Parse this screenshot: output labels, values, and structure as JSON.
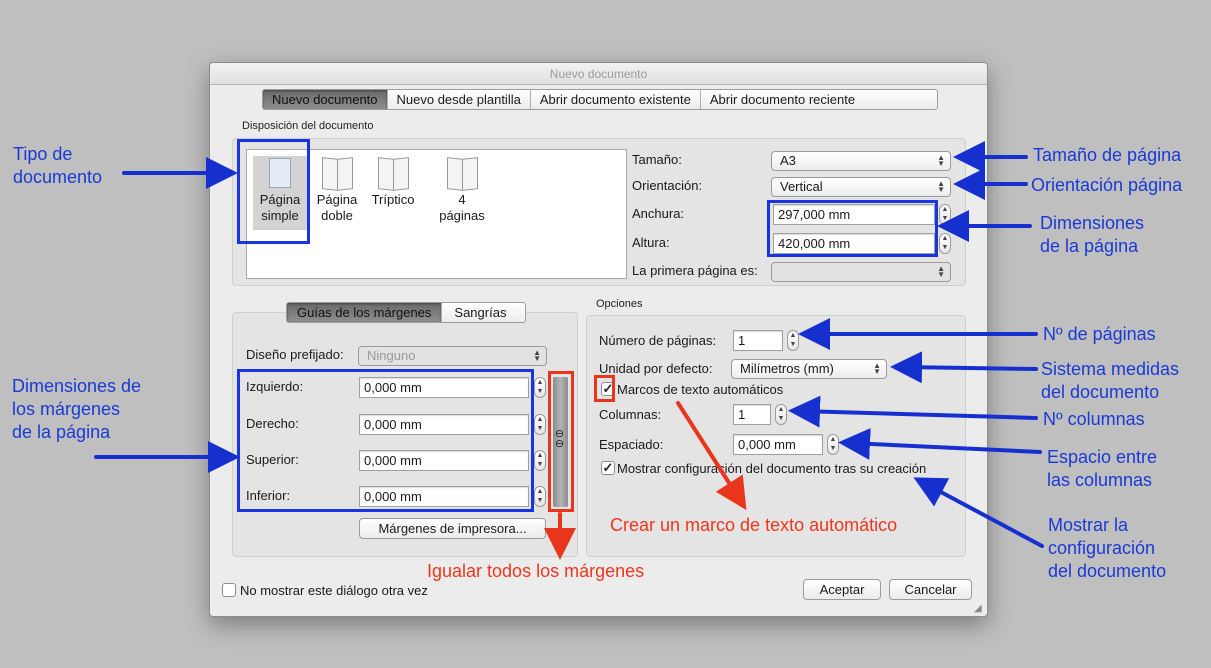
{
  "window": {
    "title": "Nuevo documento"
  },
  "tabs": [
    {
      "label": "Nuevo documento"
    },
    {
      "label": "Nuevo desde plantilla"
    },
    {
      "label": "Abrir documento existente"
    },
    {
      "label": "Abrir documento reciente"
    }
  ],
  "layout_section": {
    "caption": "Disposición del documento",
    "types": [
      {
        "label1": "Página",
        "label2": "simple"
      },
      {
        "label1": "Página",
        "label2": "doble"
      },
      {
        "label1": "Tríptico",
        "label2": ""
      },
      {
        "label1": "4",
        "label2": "páginas"
      }
    ]
  },
  "page": {
    "size_label": "Tamaño:",
    "size_value": "A3",
    "orientation_label": "Orientación:",
    "orientation_value": "Vertical",
    "width_label": "Anchura:",
    "width_value": "297,000 mm",
    "height_label": "Altura:",
    "height_value": "420,000 mm",
    "first_page_label": "La primera página es:",
    "first_page_value": ""
  },
  "margins": {
    "tabs": [
      {
        "label": "Guías de los márgenes"
      },
      {
        "label": "Sangrías"
      }
    ],
    "preset_label": "Diseño prefijado:",
    "preset_value": "Ninguno",
    "left_label": "Izquierdo:",
    "left_value": "0,000 mm",
    "right_label": "Derecho:",
    "right_value": "0,000 mm",
    "top_label": "Superior:",
    "top_value": "0,000 mm",
    "bottom_label": "Inferior:",
    "bottom_value": "0,000 mm",
    "printer_button": "Márgenes de impresora..."
  },
  "options": {
    "caption": "Opciones",
    "pages_label": "Número de páginas:",
    "pages_value": "1",
    "unit_label": "Unidad por defecto:",
    "unit_value": "Milímetros (mm)",
    "auto_frames_label": "Marcos de texto automáticos",
    "auto_frames_checked": true,
    "columns_label": "Columnas:",
    "columns_value": "1",
    "spacing_label": "Espaciado:",
    "spacing_value": "0,000 mm",
    "show_config_label": "Mostrar configuración del documento tras su creación",
    "show_config_checked": true
  },
  "footer": {
    "dont_show_label": "No mostrar este diálogo otra vez",
    "dont_show_checked": false,
    "ok_button": "Aceptar",
    "cancel_button": "Cancelar"
  },
  "annotations": {
    "doc_type": [
      "Tipo de",
      "documento"
    ],
    "page_size": "Tamaño de página",
    "orientation": "Orientación página",
    "dimensions": [
      "Dimensiones",
      "de la página"
    ],
    "num_pages": "Nº de páginas",
    "measure": [
      "Sistema medidas",
      "del documento"
    ],
    "columns": "Nº columnas",
    "spacing": [
      "Espacio entre",
      "las columnas"
    ],
    "show_config": [
      "Mostrar la",
      "configuración",
      "del documento"
    ],
    "margins": [
      "Dimensiones de",
      "los márgenes",
      "de la página"
    ],
    "auto_frame": "Crear un marco de texto automático",
    "equal_margins": "Igualar todos los márgenes"
  },
  "colors": {
    "annotation_blue": "#1a3ad6",
    "annotation_red": "#f0351b",
    "arrow_blue": "#1630d0"
  }
}
